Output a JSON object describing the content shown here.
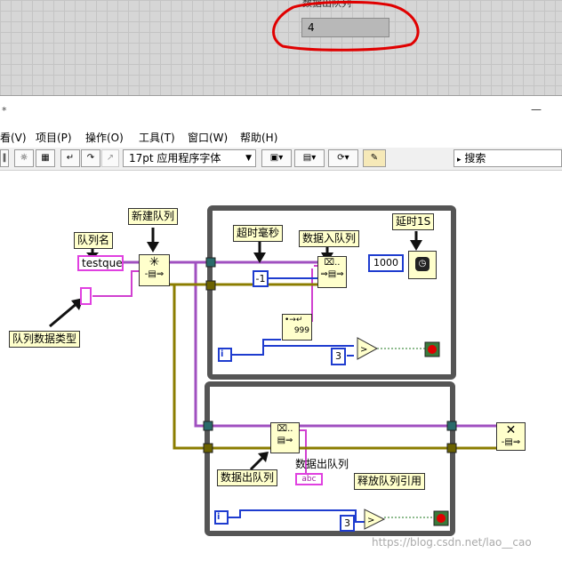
{
  "front_panel": {
    "indicator_label": "数据出队列",
    "indicator_value": "4"
  },
  "window": {
    "title_marker": "*",
    "minimize_glyph": "—"
  },
  "menu": {
    "items": [
      "看(V)",
      "项目(P)",
      "操作(O)",
      "工具(T)",
      "窗口(W)",
      "帮助(H)"
    ]
  },
  "toolbar": {
    "font_label": "17pt 应用程序字体",
    "search_placeholder": "搜索"
  },
  "diagram": {
    "labels": {
      "new_queue": "新建队列",
      "queue_name": "队列名",
      "queue_data_type": "队列数据类型",
      "timeout_ms": "超时毫秒",
      "enqueue": "数据入队列",
      "delay": "延时1S",
      "dequeue_label": "数据出队列",
      "dequeue_caption": "数据出队列",
      "release_queue": "释放队列引用"
    },
    "constants": {
      "queue_name_value": "testque",
      "timeout_value": "-1",
      "delay_value": "1000",
      "compare_top_value": "3",
      "compare_bottom_value": "3",
      "iteration_top": "i",
      "iteration_bottom": "i",
      "indicator_text": "abc"
    }
  },
  "watermark": "https://blog.csdn.net/lao__cao",
  "colors": {
    "queue_ref_wire": "#a050c0",
    "error_wire": "#8b7d00",
    "numeric_wire": "#1e3ccf",
    "boolean_wire": "#1f7a1f",
    "loop_border": "#555555",
    "annotation_red": "#e00000"
  }
}
